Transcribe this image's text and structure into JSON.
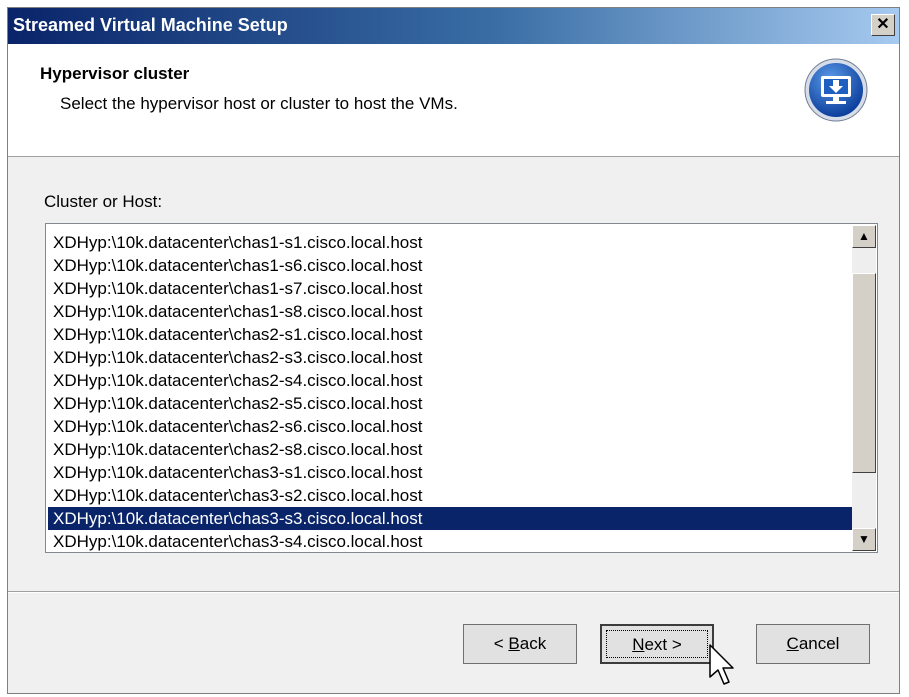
{
  "window": {
    "title": "Streamed Virtual Machine Setup",
    "close_glyph": "✕"
  },
  "header": {
    "title": "Hypervisor cluster",
    "subtitle": "Select the hypervisor host or cluster to host the VMs.",
    "icon": "download-monitor-icon"
  },
  "cluster": {
    "label": "Cluster or Host:",
    "selected_index": 12,
    "items": [
      "XDHyp:\\10k.datacenter\\chas1-s1.cisco.local.host",
      "XDHyp:\\10k.datacenter\\chas1-s6.cisco.local.host",
      "XDHyp:\\10k.datacenter\\chas1-s7.cisco.local.host",
      "XDHyp:\\10k.datacenter\\chas1-s8.cisco.local.host",
      "XDHyp:\\10k.datacenter\\chas2-s1.cisco.local.host",
      "XDHyp:\\10k.datacenter\\chas2-s3.cisco.local.host",
      "XDHyp:\\10k.datacenter\\chas2-s4.cisco.local.host",
      "XDHyp:\\10k.datacenter\\chas2-s5.cisco.local.host",
      "XDHyp:\\10k.datacenter\\chas2-s6.cisco.local.host",
      "XDHyp:\\10k.datacenter\\chas2-s8.cisco.local.host",
      "XDHyp:\\10k.datacenter\\chas3-s1.cisco.local.host",
      "XDHyp:\\10k.datacenter\\chas3-s2.cisco.local.host",
      "XDHyp:\\10k.datacenter\\chas3-s3.cisco.local.host",
      "XDHyp:\\10k.datacenter\\chas3-s4.cisco.local.host"
    ]
  },
  "buttons": {
    "back": {
      "prefix": "< ",
      "mnemonic": "B",
      "rest": "ack"
    },
    "next": {
      "mnemonic": "N",
      "rest": "ext >"
    },
    "cancel": {
      "mnemonic": "C",
      "rest": "ancel"
    }
  },
  "colors": {
    "selection": "#0a246a",
    "title_bar": "#0a246a",
    "icon_blue": "#1f5fbf"
  }
}
